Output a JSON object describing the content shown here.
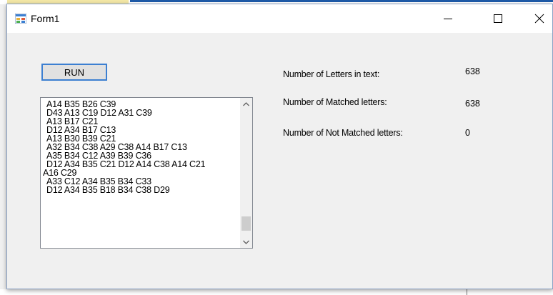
{
  "window": {
    "title": "Form1",
    "controls": [
      "minimize",
      "maximize",
      "close"
    ]
  },
  "run_button": {
    "label": "RUN"
  },
  "listbox": {
    "items": [
      "A14 B35 B26 C39",
      "D43 A13 C19 D12 A31 C39",
      "A13 B17 C21",
      "D12 A34 B17 C13",
      "A13 B30 B39 C21",
      "A32 B34 C38 A29 C38 A14 B17 C13",
      "A35 B34 C12 A39 B39 C36",
      "D12 A34 B35 C21 D12 A14 C38 A14 C21",
      "A16 C29",
      "A33 C12 A34 B35 B34 C33",
      "D12 A34 B35 B18 B34 C38 D29"
    ],
    "scrollbar": {
      "up": "chevron-up-icon",
      "down": "chevron-down-icon"
    }
  },
  "stats": {
    "letters_label": "Number of Letters in text:",
    "letters_value": "638",
    "matched_label": "Number of Matched letters:",
    "matched_value": "638",
    "not_matched_label": "Number of Not Matched letters:",
    "not_matched_value": "0"
  },
  "colors": {
    "accent": "#3c7fd1",
    "window_bg": "#f0f0f0",
    "title_bg": "#ffffff"
  }
}
